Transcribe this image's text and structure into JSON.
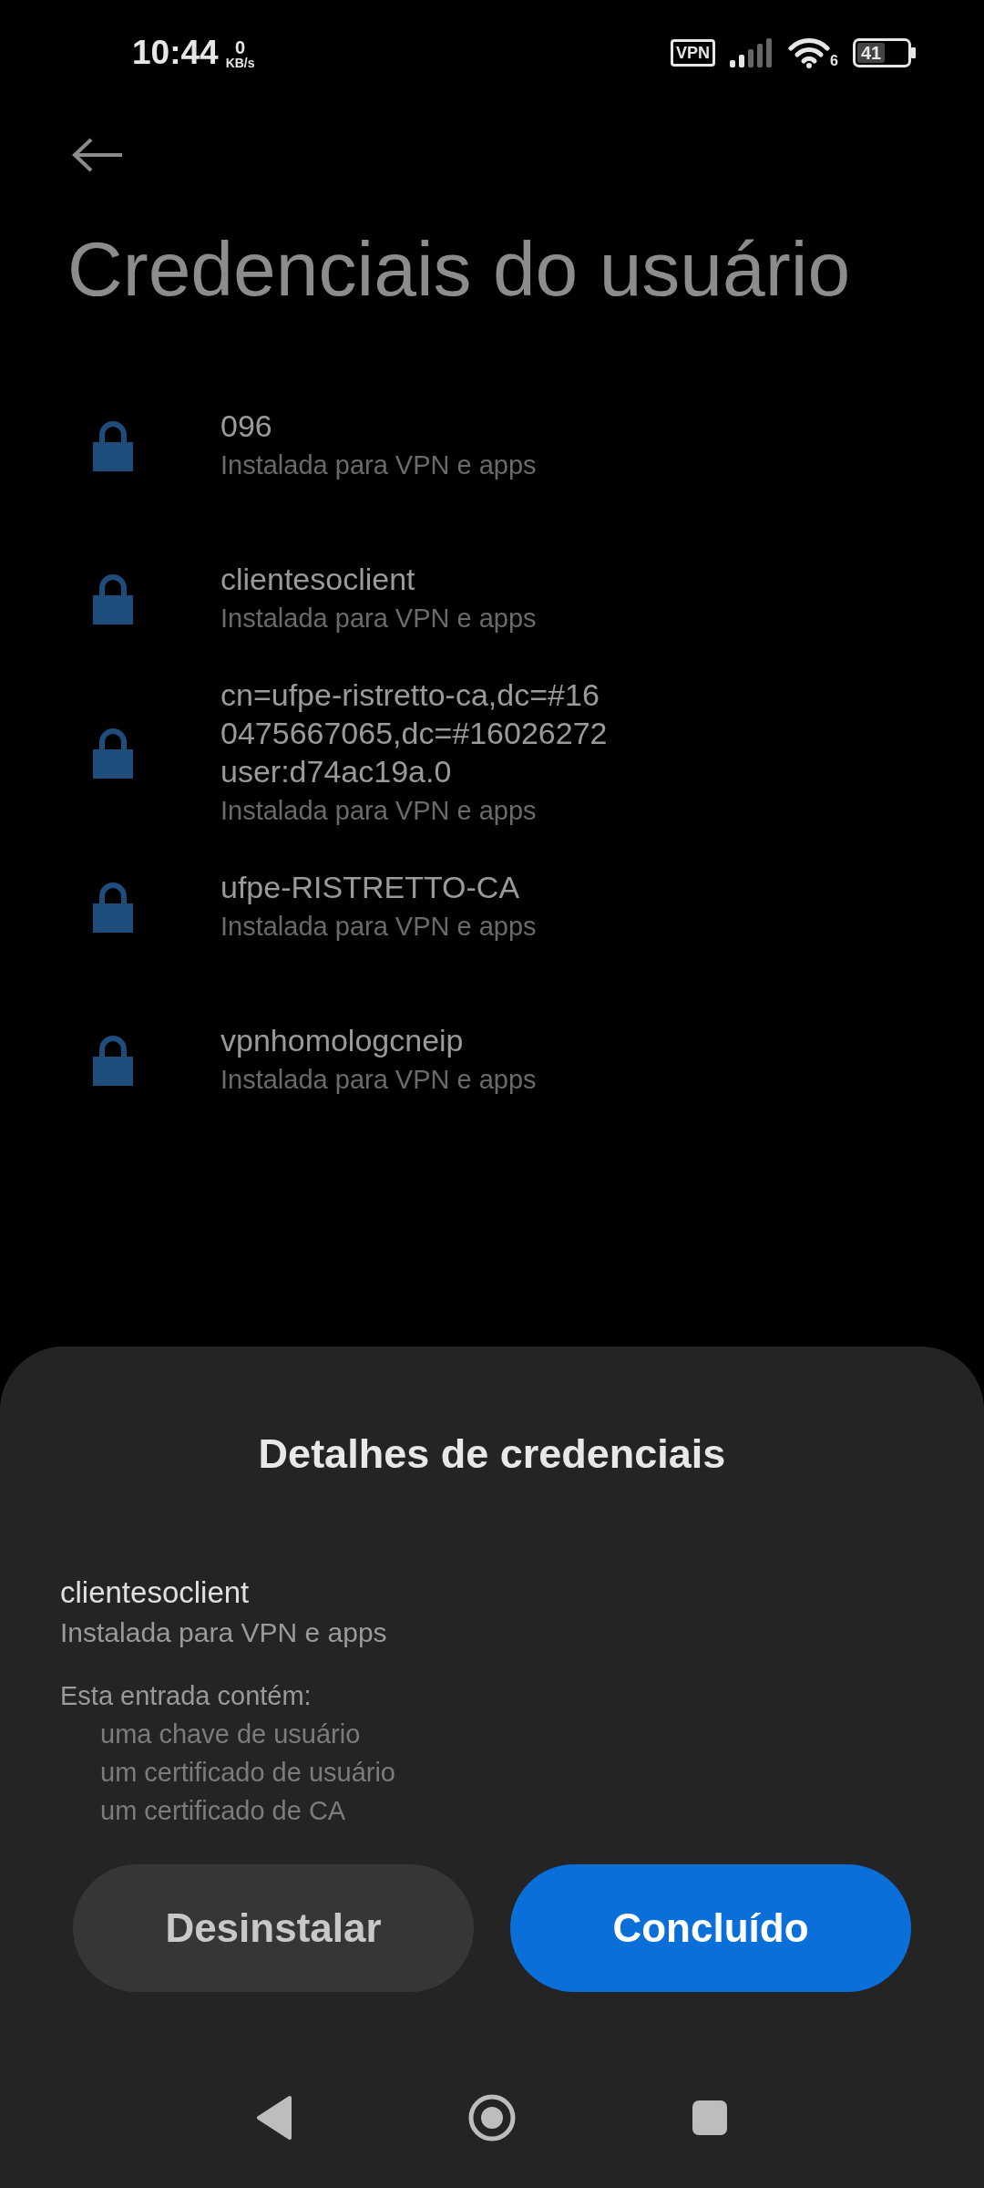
{
  "status_bar": {
    "time": "10:44",
    "net_speed": "0",
    "net_unit": "KB/s",
    "vpn": "VPN",
    "wifi_badge": "6",
    "battery": "41"
  },
  "page": {
    "title": "Credenciais do usuário"
  },
  "credentials": [
    {
      "name_lines": [
        "096"
      ],
      "subtitle": "Instalada para VPN e apps"
    },
    {
      "name_lines": [
        "clientesoclient"
      ],
      "subtitle": "Instalada para VPN e apps"
    },
    {
      "name_lines": [
        "cn=ufpe-ristretto-ca,dc=#16",
        "0475667065,dc=#16026272",
        "user:d74ac19a.0"
      ],
      "subtitle": "Instalada para VPN e apps"
    },
    {
      "name_lines": [
        "ufpe-RISTRETTO-CA"
      ],
      "subtitle": "Instalada para VPN e apps"
    },
    {
      "name_lines": [
        "vpnhomologcneip"
      ],
      "subtitle": "Instalada para VPN e apps"
    }
  ],
  "sheet": {
    "title": "Detalhes de credenciais",
    "name": "clientesoclient",
    "subtitle": "Instalada para VPN e apps",
    "contents_label": "Esta entrada contém:",
    "contents": [
      "uma chave de usuário",
      "um certificado de usuário",
      "um certificado de CA"
    ],
    "buttons": [
      {
        "label": "Desinstalar",
        "kind": "secondary"
      },
      {
        "label": "Concluído",
        "kind": "primary"
      }
    ]
  }
}
